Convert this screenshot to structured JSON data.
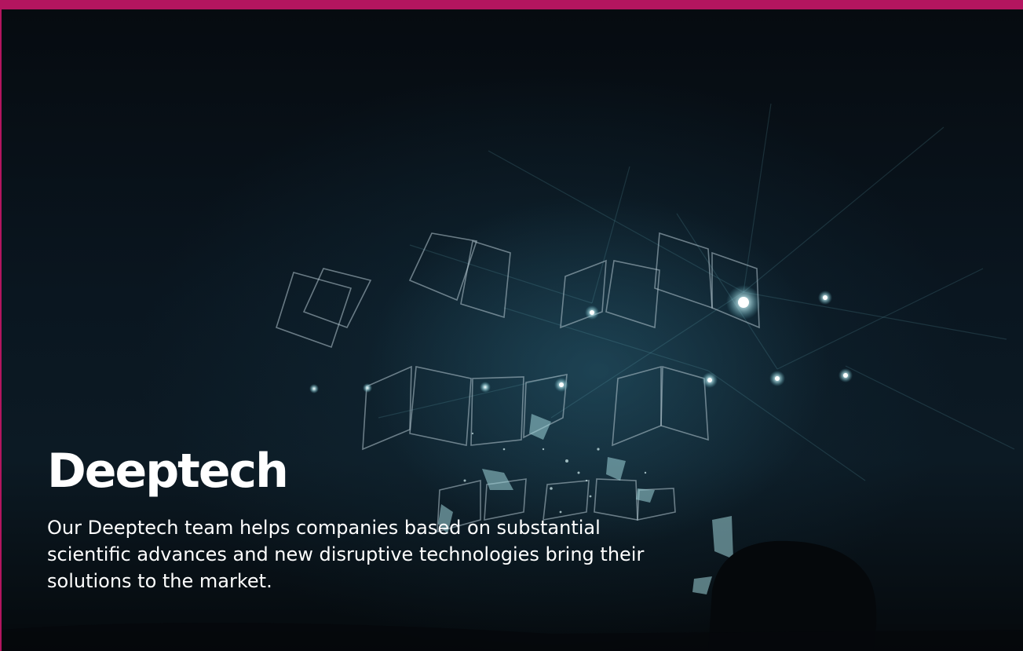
{
  "hero": {
    "title": "Deeptech",
    "description": "Our Deeptech team helps companies based on substantial scientific advances and new disruptive technologies bring their solutions to the market."
  },
  "colors": {
    "frame": "#b3155f",
    "background": "#0a1620",
    "text": "#ffffff",
    "light": "#cfeef0"
  }
}
